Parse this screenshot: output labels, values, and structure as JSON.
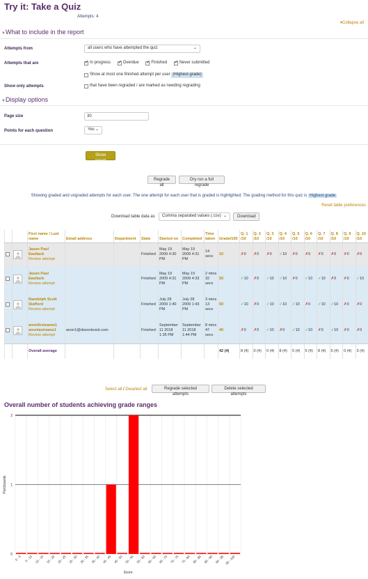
{
  "page": {
    "title": "Try it: Take a Quiz",
    "attempts_text": "Attempts: 4",
    "collapse_all": "Collapse all"
  },
  "report_section": {
    "header": "What to include in the report",
    "attempts_from_label": "Attempts from",
    "attempts_from_value": "all users who have attempted the quiz",
    "attempts_that_are_label": "Attempts that are",
    "states": [
      {
        "label": "In progress",
        "checked": true
      },
      {
        "label": "Overdue",
        "checked": true
      },
      {
        "label": "Finished",
        "checked": true
      },
      {
        "label": "Never submitted",
        "checked": true
      }
    ],
    "show_one_prefix": "Show at most one finished attempt per user",
    "show_one_highlight": "(Highest grade)",
    "show_only_label": "Show only attempts",
    "show_only_text": "that have been regraded / are marked as needing regrading"
  },
  "display_section": {
    "header": "Display options",
    "page_size_label": "Page size",
    "page_size_value": "30",
    "marks_label": "Points for each question",
    "marks_value": "Yes",
    "show_report": "Show report"
  },
  "regrade": {
    "regrade_all": "Regrade all",
    "dry_run": "Dry run a full regrade",
    "info_text": "Showing graded and ungraded attempts for each user. The one attempt for each user that is graded is highlighted. The grading method for this quiz is",
    "info_highlight": "Highest grade",
    "reset_prefs": "Reset table preferences",
    "download_label": "Download table data as",
    "download_format": "Comma separated values (.csv)",
    "download_button": "Download"
  },
  "table": {
    "headers": {
      "name": "First name / Last name",
      "email": "Email address",
      "department": "Department",
      "state": "State",
      "started": "Started on",
      "completed": "Completed",
      "time": "Time taken",
      "grade": "Grade/100",
      "questions": [
        "Q. 1 /10",
        "Q. 2 /10",
        "Q. 3 /10",
        "Q. 4 /10",
        "Q. 5 /10",
        "Q. 6 /10",
        "Q. 7 /10",
        "Q. 8 /10",
        "Q. 9 /10",
        "Q. 10 /10"
      ]
    },
    "rows": [
      {
        "style": "grey",
        "name": "Jason Paul Eastlack",
        "review": "Review attempt",
        "email": "",
        "department": "",
        "state": "Finished",
        "started": "May 19 2009 4:30 PM",
        "completed": "May 19 2009 4:31 PM",
        "time": "14 secs",
        "grade": "10",
        "q": [
          [
            "x",
            "0"
          ],
          [
            "x",
            "0"
          ],
          [
            "x",
            "0"
          ],
          [
            "ok",
            "10"
          ],
          [
            "x",
            "0"
          ],
          [
            "x",
            "0"
          ],
          [
            "x",
            "0"
          ],
          [
            "x",
            "0"
          ],
          [
            "x",
            "0"
          ],
          [
            "x",
            "0"
          ]
        ]
      },
      {
        "style": "blue",
        "name": "Jason Paul Eastlack",
        "review": "Review attempt",
        "email": "",
        "department": "",
        "state": "Finished",
        "started": "May 19 2009 4:31 PM",
        "completed": "May 19 2009 4:33 PM",
        "time": "2 mins 32 secs",
        "grade": "50",
        "q": [
          [
            "ok",
            "10"
          ],
          [
            "x",
            "0"
          ],
          [
            "ok",
            "10"
          ],
          [
            "ok",
            "10"
          ],
          [
            "x",
            "0"
          ],
          [
            "ok",
            "10"
          ],
          [
            "ok",
            "10"
          ],
          [
            "x",
            "0"
          ],
          [
            "x",
            "0"
          ],
          [
            "ok",
            "10"
          ]
        ]
      },
      {
        "style": "blue",
        "name": "Randolph Scott Stafford",
        "review": "Review attempt",
        "email": "",
        "department": "",
        "state": "Finished",
        "started": "July 28 2009 1:40 PM",
        "completed": "July 28 2009 1:43 PM",
        "time": "3 mins 13 secs",
        "grade": "50",
        "q": [
          [
            "ok",
            "10"
          ],
          [
            "x",
            "0"
          ],
          [
            "ok",
            "10"
          ],
          [
            "ok",
            "10"
          ],
          [
            "ok",
            "10"
          ],
          [
            "x",
            "0"
          ],
          [
            "ok",
            "10"
          ],
          [
            "ok",
            "10"
          ],
          [
            "x",
            "0"
          ],
          [
            "x",
            "0"
          ]
        ]
      },
      {
        "style": "blue",
        "name": "anonfirstname1 anonlastname1",
        "review": "Review attempt",
        "email": "anon1@doesntexist.com",
        "department": "",
        "state": "Finished",
        "started": "September 11 2018 1:35 PM",
        "completed": "September 11 2018 1:44 PM",
        "time": "8 mins 47 secs",
        "grade": "40",
        "q": [
          [
            "x",
            "0"
          ],
          [
            "x",
            "0"
          ],
          [
            "ok",
            "10"
          ],
          [
            "x",
            "0"
          ],
          [
            "ok",
            "10"
          ],
          [
            "ok",
            "10"
          ],
          [
            "x",
            "0"
          ],
          [
            "ok",
            "10"
          ],
          [
            "x",
            "0"
          ],
          [
            "x",
            "0"
          ]
        ]
      }
    ],
    "average": {
      "label": "Overall average",
      "grade": "42 (4)",
      "q": [
        "8 (4)",
        "0 (4)",
        "0 (4)",
        "8 (4)",
        "5 (4)",
        "5 (4)",
        "8 (4)",
        "5 (4)",
        "0 (4)",
        "3 (4)"
      ]
    },
    "select_all": "Select all",
    "sep": " / ",
    "deselect_all": "Deselect all",
    "regrade_selected": "Regrade selected attempts",
    "delete_selected": "Delete selected attempts"
  },
  "chart_title": "Overall number of students achieving grade ranges",
  "chart_data": {
    "type": "bar",
    "categories": [
      "0 - 5",
      "5 - 10",
      "10 - 15",
      "15 - 20",
      "20 - 25",
      "25 - 30",
      "30 - 35",
      "35 - 40",
      "40 - 45",
      "45 - 50",
      "50 - 55",
      "55 - 60",
      "60 - 65",
      "65 - 70",
      "70 - 75",
      "75 - 80",
      "80 - 85",
      "85 - 90",
      "90 - 95",
      "95 - 100"
    ],
    "values": [
      0,
      0,
      0,
      0,
      0,
      0,
      0,
      0,
      1,
      0,
      2,
      0,
      0,
      0,
      0,
      0,
      0,
      0,
      0,
      0
    ],
    "xlabel": "Score",
    "ylabel": "Participants",
    "ylim": [
      0,
      2
    ],
    "yticks": [
      "0",
      "1",
      "2"
    ],
    "bar_color": "#ff0000"
  }
}
